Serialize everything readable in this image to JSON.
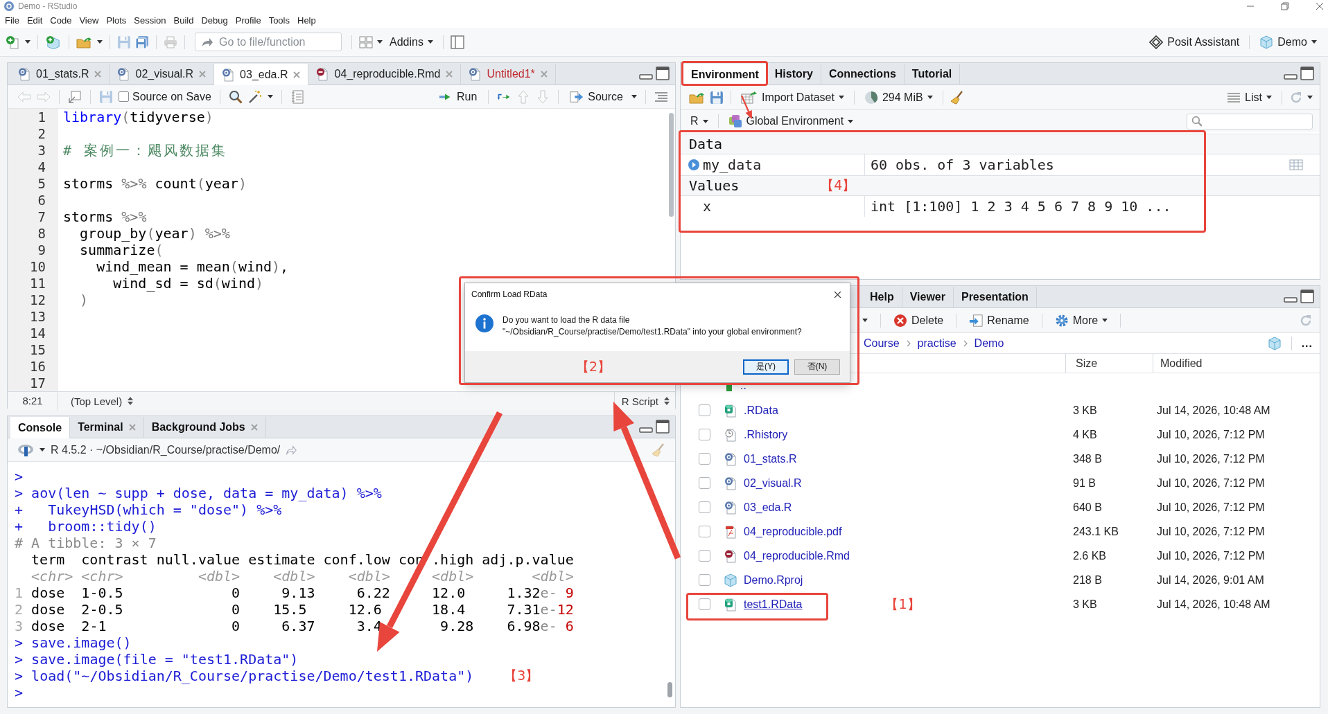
{
  "window": {
    "title": "Demo - RStudio"
  },
  "menu": [
    "File",
    "Edit",
    "Code",
    "View",
    "Plots",
    "Session",
    "Build",
    "Debug",
    "Profile",
    "Tools",
    "Help"
  ],
  "toolbar": {
    "goto_placeholder": "Go to file/function",
    "addins": "Addins",
    "assistant": "Posit Assistant",
    "project": "Demo"
  },
  "editor": {
    "tabs": [
      {
        "label": "01_stats.R",
        "kind": "r",
        "selected": false,
        "modified": false
      },
      {
        "label": "02_visual.R",
        "kind": "r",
        "selected": false,
        "modified": false
      },
      {
        "label": "03_eda.R",
        "kind": "r",
        "selected": true,
        "modified": false
      },
      {
        "label": "04_reproducible.Rmd",
        "kind": "rmd",
        "selected": false,
        "modified": false
      },
      {
        "label": "Untitled1*",
        "kind": "r",
        "selected": false,
        "modified": true
      }
    ],
    "source_on_save": {
      "label": "Source on Save",
      "checked": false
    },
    "run": "Run",
    "source": "Source",
    "lines": [
      {
        "number": "1",
        "segments": [
          {
            "text": "library",
            "kind": "keyword"
          },
          {
            "text": "(",
            "kind": "op"
          },
          {
            "text": "tidyverse",
            "kind": "plain"
          },
          {
            "text": ")",
            "kind": "op"
          }
        ]
      },
      {
        "number": "2"
      },
      {
        "number": "3",
        "segments": [
          {
            "text": "# 案例一：飓风数据集",
            "kind": "comment"
          }
        ]
      },
      {
        "number": "4"
      },
      {
        "number": "5",
        "segments": [
          {
            "text": "storms ",
            "kind": "plain"
          },
          {
            "text": "%>%",
            "kind": "op"
          },
          {
            "text": " count",
            "kind": "plain"
          },
          {
            "text": "(",
            "kind": "op"
          },
          {
            "text": "year",
            "kind": "plain"
          },
          {
            "text": ")",
            "kind": "op"
          }
        ]
      },
      {
        "number": "6"
      },
      {
        "number": "7",
        "segments": [
          {
            "text": "storms ",
            "kind": "plain"
          },
          {
            "text": "%>%",
            "kind": "op"
          }
        ]
      },
      {
        "number": "8",
        "segments": [
          {
            "text": "  group_by",
            "kind": "plain"
          },
          {
            "text": "(",
            "kind": "op"
          },
          {
            "text": "year",
            "kind": "plain"
          },
          {
            "text": ") %>%",
            "kind": "op"
          }
        ]
      },
      {
        "number": "9",
        "segments": [
          {
            "text": "  summarize",
            "kind": "plain"
          },
          {
            "text": "(",
            "kind": "op"
          }
        ]
      },
      {
        "number": "10",
        "segments": [
          {
            "text": "    wind_mean = mean",
            "kind": "plain"
          },
          {
            "text": "(",
            "kind": "op"
          },
          {
            "text": "wind",
            "kind": "plain"
          },
          {
            "text": ")",
            "kind": "op"
          },
          {
            "text": ",",
            "kind": "plain"
          }
        ]
      },
      {
        "number": "11",
        "segments": [
          {
            "text": "      wind_sd = sd",
            "kind": "plain"
          },
          {
            "text": "(",
            "kind": "op"
          },
          {
            "text": "wind",
            "kind": "plain"
          },
          {
            "text": ")",
            "kind": "op"
          }
        ]
      },
      {
        "number": "12",
        "segments": [
          {
            "text": "  )",
            "kind": "op"
          }
        ]
      },
      {
        "number": "13"
      },
      {
        "number": "14"
      },
      {
        "number": "15"
      },
      {
        "number": "16"
      },
      {
        "number": "17"
      }
    ],
    "position": "8:21",
    "scope": "(Top Level)",
    "file_type": "R Script"
  },
  "console": {
    "tabs": [
      {
        "label": "Console",
        "selected": true,
        "closable": false
      },
      {
        "label": "Terminal",
        "selected": false,
        "closable": true
      },
      {
        "label": "Background Jobs",
        "selected": false,
        "closable": true
      }
    ],
    "header": "R 4.5.2 · ~/Obsidian/R_Course/practise/Demo/",
    "lines": [
      {
        "segments": [
          {
            "text": ">",
            "kind": "prompt"
          }
        ]
      },
      {
        "segments": [
          {
            "text": "> ",
            "kind": "prompt"
          },
          {
            "text": "aov(len ~ supp + dose, data = my_data) %>%",
            "kind": "cmd"
          }
        ]
      },
      {
        "segments": [
          {
            "text": "+ ",
            "kind": "prompt"
          },
          {
            "text": "  TukeyHSD(which = \"dose\") %>%",
            "kind": "cmd"
          }
        ]
      },
      {
        "segments": [
          {
            "text": "+ ",
            "kind": "prompt"
          },
          {
            "text": "  broom::tidy()",
            "kind": "cmd"
          }
        ]
      },
      {
        "segments": [
          {
            "text": "# A tibble: 3 × 7",
            "kind": "meta"
          }
        ]
      },
      {
        "segments": [
          {
            "text": "  term  contrast null.value estimate conf.low con .high adj.p.value",
            "kind": "out"
          }
        ]
      },
      {
        "segments": [
          {
            "text": "  <chr> <chr>         <dbl>    <dbl>    <dbl>     <dbl>       <dbl>",
            "kind": "type"
          }
        ]
      },
      {
        "segments": [
          {
            "text": "1",
            "kind": "rownum"
          },
          {
            "text": " dose  1-0.5             0     9.13     6.22     12.0     1.32",
            "kind": "out"
          },
          {
            "text": "e-",
            "kind": "meta"
          },
          {
            "text": " 9",
            "kind": "exp"
          }
        ]
      },
      {
        "segments": [
          {
            "text": "2",
            "kind": "rownum"
          },
          {
            "text": " dose  2-0.5             0    15.5     12.6      18.4     7.31",
            "kind": "out"
          },
          {
            "text": "e-",
            "kind": "meta"
          },
          {
            "text": "12",
            "kind": "exp"
          }
        ]
      },
      {
        "segments": [
          {
            "text": "3",
            "kind": "rownum"
          },
          {
            "text": " dose  2-1               0     6.37     3.4       9.28    6.98",
            "kind": "out"
          },
          {
            "text": "e-",
            "kind": "meta"
          },
          {
            "text": " 6",
            "kind": "exp"
          }
        ]
      },
      {
        "segments": [
          {
            "text": "> ",
            "kind": "prompt"
          },
          {
            "text": "save.image()",
            "kind": "cmd"
          }
        ]
      },
      {
        "segments": [
          {
            "text": "> ",
            "kind": "prompt"
          },
          {
            "text": "save.image(file = \"test1.RData\")",
            "kind": "cmd"
          }
        ]
      },
      {
        "segments": [
          {
            "text": "> ",
            "kind": "prompt"
          },
          {
            "text": "load(\"~/Obsidian/R_Course/practise/Demo/test1.RData\")",
            "kind": "cmd"
          }
        ],
        "callout": "【3】"
      },
      {
        "segments": [
          {
            "text": ">",
            "kind": "prompt"
          }
        ]
      }
    ]
  },
  "environment": {
    "tabs": [
      {
        "label": "Environment",
        "selected": true,
        "highlighted": true
      },
      {
        "label": "History",
        "selected": false,
        "highlighted": false
      },
      {
        "label": "Connections",
        "selected": false,
        "highlighted": false
      },
      {
        "label": "Tutorial",
        "selected": false,
        "highlighted": false
      }
    ],
    "import": "Import Dataset",
    "memory": "294 MiB",
    "view": "List",
    "language": "R",
    "scope": "Global Environment",
    "highlighted": true,
    "groups": [
      {
        "title": "Data",
        "rows": [
          {
            "name": "my_data",
            "value": "60 obs. of 3 variables",
            "kind": "data"
          }
        ]
      },
      {
        "title": "Values",
        "callout": "【4】",
        "rows": [
          {
            "name": "x",
            "value": "int [1:100] 1 2 3 4 5 6 7 8 9 10 ...",
            "kind": "value"
          }
        ]
      }
    ]
  },
  "files": {
    "tabs": [
      {
        "label": "Help",
        "selected": false
      },
      {
        "label": "Viewer",
        "selected": false
      },
      {
        "label": "Presentation",
        "selected": false
      }
    ],
    "actions": [
      {
        "kind": "menu"
      },
      {
        "label": "Delete",
        "kind": "delete"
      },
      {
        "label": "Rename",
        "kind": "rename"
      },
      {
        "label": "More",
        "kind": "more"
      }
    ],
    "breadcrumb": [
      "Course",
      "practise",
      "Demo"
    ],
    "overflow": "...",
    "columns": [
      "Size",
      "Modified"
    ],
    "parent": "..",
    "rows": [
      {
        "name": ".RData",
        "kind": "rdata",
        "size": "3 KB",
        "modified": "Jul 14, 2026, 10:48 AM",
        "checked": false,
        "hovered": false,
        "highlighted": false
      },
      {
        "name": ".Rhistory",
        "kind": "history",
        "size": "4 KB",
        "modified": "Jul 10, 2026, 7:12 PM",
        "checked": false,
        "hovered": false,
        "highlighted": false
      },
      {
        "name": "01_stats.R",
        "kind": "r",
        "size": "348 B",
        "modified": "Jul 10, 2026, 7:12 PM",
        "checked": false,
        "hovered": false,
        "highlighted": false
      },
      {
        "name": "02_visual.R",
        "kind": "r",
        "size": "91 B",
        "modified": "Jul 10, 2026, 7:12 PM",
        "checked": false,
        "hovered": false,
        "highlighted": false
      },
      {
        "name": "03_eda.R",
        "kind": "r",
        "size": "640 B",
        "modified": "Jul 10, 2026, 7:12 PM",
        "checked": false,
        "hovered": false,
        "highlighted": false
      },
      {
        "name": "04_reproducible.pdf",
        "kind": "pdf",
        "size": "243.1 KB",
        "modified": "Jul 10, 2026, 7:12 PM",
        "checked": false,
        "hovered": false,
        "highlighted": false
      },
      {
        "name": "04_reproducible.Rmd",
        "kind": "rmd",
        "size": "2.6 KB",
        "modified": "Jul 10, 2026, 7:12 PM",
        "checked": false,
        "hovered": false,
        "highlighted": false
      },
      {
        "name": "Demo.Rproj",
        "kind": "rproj",
        "size": "218 B",
        "modified": "Jul 14, 2026, 9:01 AM",
        "checked": false,
        "hovered": false,
        "highlighted": false
      },
      {
        "name": "test1.RData",
        "kind": "rdata",
        "size": "3 KB",
        "modified": "Jul 14, 2026, 10:48 AM",
        "checked": false,
        "hovered": true,
        "highlighted": true,
        "callout": "【1】"
      }
    ]
  },
  "dialog": {
    "title": "Confirm Load RData",
    "message": [
      "Do you want to load the R data file",
      "\"~/Obsidian/R_Course/practise/Demo/test1.RData\" into your global environment?"
    ],
    "callout": "【2】",
    "highlighted": true,
    "buttons": [
      {
        "label": "是(Y)",
        "selected": true
      },
      {
        "label": "否(N)",
        "selected": false
      }
    ]
  }
}
